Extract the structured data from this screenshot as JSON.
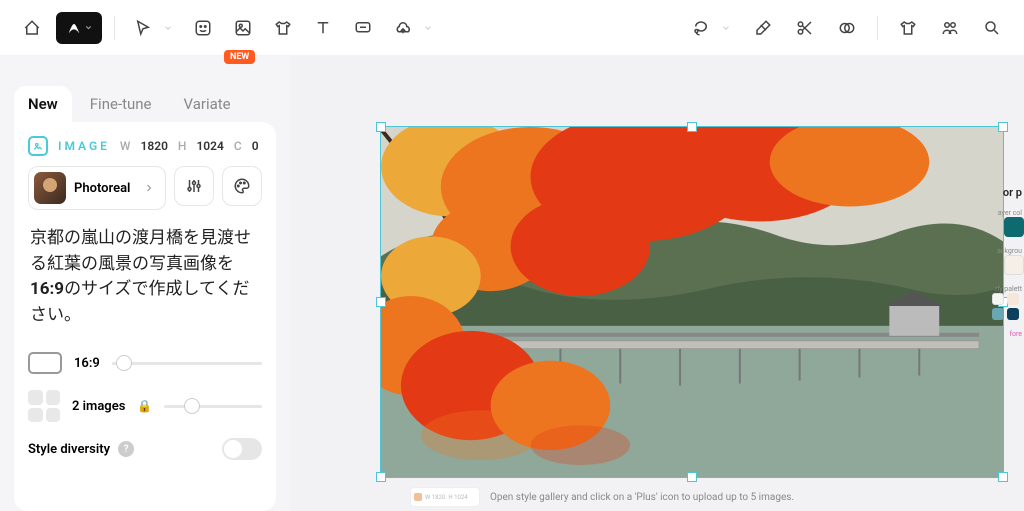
{
  "toolbar": {
    "new_badge": "NEW"
  },
  "side": {
    "tabs": [
      "New",
      "Fine-tune",
      "Variate"
    ],
    "active_tab": 0,
    "image_label": "IMAGE",
    "width_label": "W",
    "width": "1820",
    "height_label": "H",
    "height": "1024",
    "rot_label": "C",
    "rotation": "0",
    "preset_name": "Photoreal",
    "prompt_plain1": "京都の嵐山の渡月橋を見渡せる紅葉の風景の写真画像を",
    "prompt_bold": "16:9",
    "prompt_plain2": "のサイズで作成してください。",
    "aspect": "16:9",
    "images_count": "2 images",
    "style_diversity": "Style diversity"
  },
  "canvas": {
    "hint": "Open style gallery and click on a 'Plus' icon to upload up to 5 images."
  },
  "right": {
    "header": "or p",
    "layer_label": "ayer col",
    "layer_color": "#0d6a6f",
    "bg_label": "ackgrou",
    "bg_color": "#f6efe8",
    "palette_label": "rly palett",
    "colors": [
      "#f5f5f2",
      "#f5e7da",
      "#69a8b3",
      "#0d405d"
    ],
    "more_label": "fore"
  }
}
